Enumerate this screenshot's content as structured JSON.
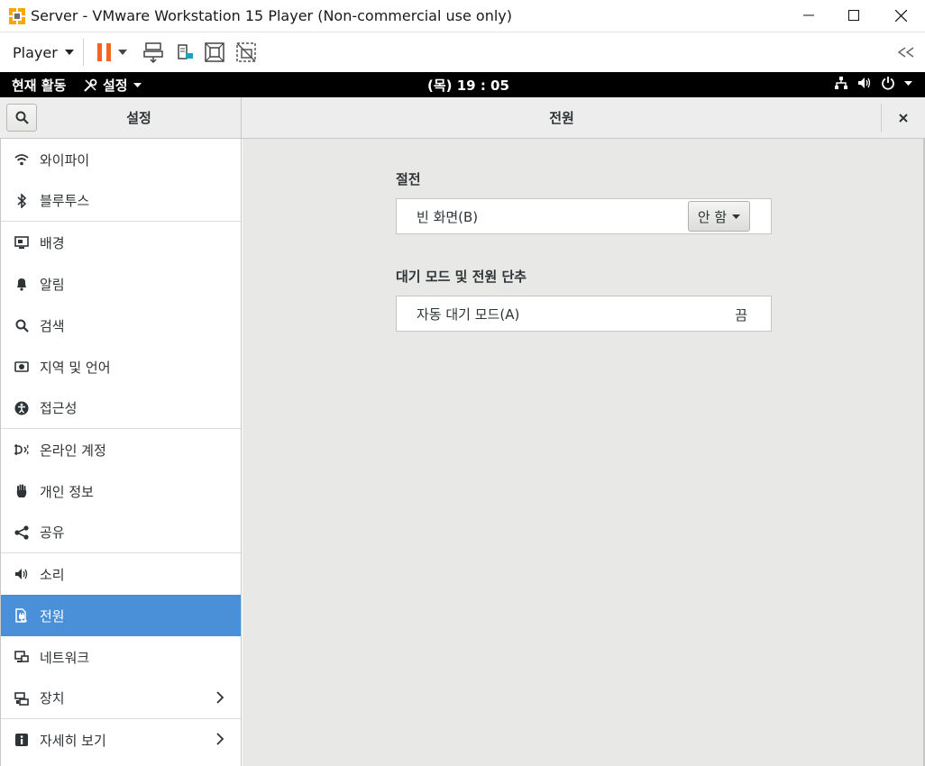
{
  "window": {
    "title": "Server - VMware Workstation 15 Player (Non-commercial use only)"
  },
  "toolbar": {
    "player_label": "Player"
  },
  "gnome": {
    "activities": "현재 활동",
    "app_menu": "설정",
    "clock": "(목) 19 : 05"
  },
  "header": {
    "sidebar_title": "설정",
    "panel_title": "전원"
  },
  "sidebar": {
    "items": [
      {
        "label": "와이파이",
        "icon": "wifi-icon"
      },
      {
        "label": "블루투스",
        "icon": "bluetooth-icon"
      },
      {
        "label": "배경",
        "icon": "background-icon"
      },
      {
        "label": "알림",
        "icon": "bell-icon"
      },
      {
        "label": "검색",
        "icon": "search-icon"
      },
      {
        "label": "지역 및 언어",
        "icon": "region-icon"
      },
      {
        "label": "접근성",
        "icon": "accessibility-icon"
      },
      {
        "label": "온라인 계정",
        "icon": "online-accounts-icon"
      },
      {
        "label": "개인 정보",
        "icon": "privacy-hand-icon"
      },
      {
        "label": "공유",
        "icon": "share-icon"
      },
      {
        "label": "소리",
        "icon": "speaker-icon"
      },
      {
        "label": "전원",
        "icon": "power-plug-icon",
        "active": true
      },
      {
        "label": "네트워크",
        "icon": "network-icon"
      },
      {
        "label": "장치",
        "icon": "devices-icon"
      },
      {
        "label": "자세히 보기",
        "icon": "info-icon"
      }
    ]
  },
  "main": {
    "power_saving": {
      "title": "절전",
      "blank_screen_label": "빈 화면(B)",
      "blank_screen_value": "안 함"
    },
    "suspend": {
      "title": "대기 모드 및 전원 단추",
      "auto_suspend_label": "자동 대기 모드(A)",
      "auto_suspend_value": "끔"
    }
  },
  "colors": {
    "accent": "#4a90d9",
    "topbar": "#000000",
    "pause": "#f26522"
  }
}
